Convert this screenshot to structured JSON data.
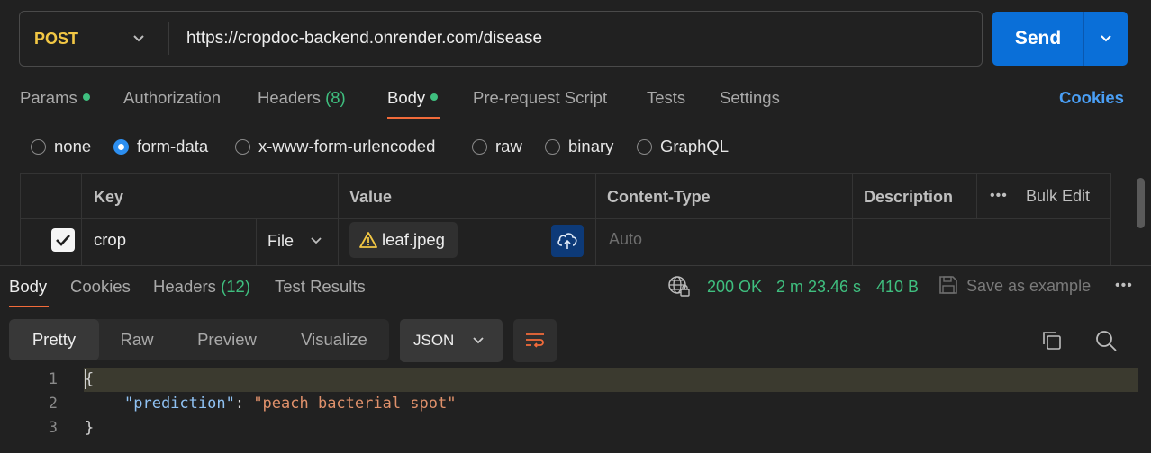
{
  "request": {
    "method": "POST",
    "url": "https://cropdoc-backend.onrender.com/disease",
    "send_label": "Send"
  },
  "request_tabs": {
    "params": "Params",
    "authorization": "Authorization",
    "headers": "Headers",
    "headers_count": "(8)",
    "body": "Body",
    "prerequest": "Pre-request Script",
    "tests": "Tests",
    "settings": "Settings",
    "cookies": "Cookies"
  },
  "body_types": [
    {
      "label": "none",
      "selected": false
    },
    {
      "label": "form-data",
      "selected": true
    },
    {
      "label": "x-www-form-urlencoded",
      "selected": false
    },
    {
      "label": "raw",
      "selected": false
    },
    {
      "label": "binary",
      "selected": false
    },
    {
      "label": "GraphQL",
      "selected": false
    }
  ],
  "form_table": {
    "headers": {
      "key": "Key",
      "value": "Value",
      "content_type": "Content-Type",
      "description": "Description"
    },
    "bulk_edit": "Bulk Edit",
    "rows": [
      {
        "checked": true,
        "key": "crop",
        "type": "File",
        "value": "leaf.jpeg",
        "content_type_placeholder": "Auto",
        "description": ""
      }
    ]
  },
  "response_tabs": {
    "body": "Body",
    "cookies": "Cookies",
    "headers": "Headers",
    "headers_count": "(12)",
    "test_results": "Test Results"
  },
  "response_meta": {
    "status": "200 OK",
    "time": "2 m 23.46 s",
    "size": "410 B",
    "save_example": "Save as example"
  },
  "view_modes": [
    "Pretty",
    "Raw",
    "Preview",
    "Visualize"
  ],
  "active_view": "Pretty",
  "format": "JSON",
  "code": {
    "line_numbers": [
      "1",
      "2",
      "3"
    ],
    "open_brace": "{",
    "key": "\"prediction\"",
    "colon": ": ",
    "value": "\"peach bacterial spot\"",
    "close_brace": "}"
  },
  "colors": {
    "accent_orange": "#f26b3a",
    "send_blue": "#0a6fd8",
    "status_green": "#3fbf7f",
    "method_yellow": "#f2c744",
    "link_blue": "#4a9ff5"
  },
  "icons": [
    "chevron-down-icon",
    "warning-icon",
    "cloud-upload-icon",
    "globe-lock-icon",
    "save-icon",
    "more-icon",
    "wrap-lines-icon",
    "copy-icon",
    "search-icon",
    "checkbox-checked-icon"
  ]
}
